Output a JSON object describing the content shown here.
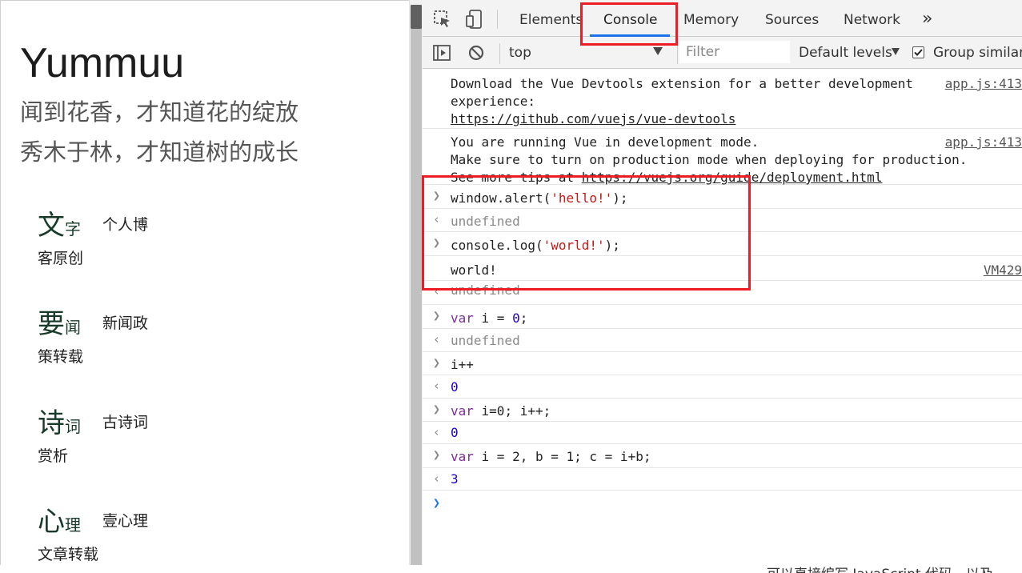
{
  "page": {
    "site_title": "Yummuu",
    "tagline_line1": "闻到花香，才知道花的绽放",
    "tagline_line2": "秀木于林，才知道树的成长",
    "categories": [
      {
        "big": "文",
        "small": "字",
        "desc1": "个人博",
        "desc2": "客原创"
      },
      {
        "big": "要",
        "small": "闻",
        "desc1": "新闻政",
        "desc2": "策转载"
      },
      {
        "big": "诗",
        "small": "词",
        "desc1": "古诗词",
        "desc2": "赏析"
      },
      {
        "big": "心",
        "small": "理",
        "desc1": "壹心理",
        "desc2": "文章转载"
      }
    ]
  },
  "devtools": {
    "tabs": [
      "Elements",
      "Console",
      "Memory",
      "Sources",
      "Network"
    ],
    "more_tabs": "»",
    "active_tab": "Console",
    "context": "top",
    "filter_placeholder": "Filter",
    "levels": "Default levels",
    "group_similar": "Group similar",
    "accent": "#1a73e8",
    "highlight": "#ee1c25"
  },
  "console": {
    "msg1_line1": "Download the Vue Devtools extension for a better development",
    "msg1_line2": "experience:",
    "msg1_link": "https://github.com/vuejs/vue-devtools",
    "msg1_src": "app.js:413",
    "msg2_line1": "You are running Vue in development mode.",
    "msg2_line2": "Make sure to turn on production mode when deploying for production.",
    "msg2_line3_prefix": "See more tips at ",
    "msg2_link": "https://vuejs.org/guide/deployment.html",
    "msg2_src": "app.js:413",
    "in1_a": "window.alert(",
    "in1_str": "'hello!'",
    "in1_b": ");",
    "out1": "undefined",
    "in2_a": "console.log(",
    "in2_str": "'world!'",
    "in2_b": ");",
    "log2": "world!",
    "log2_src": "VM429",
    "out2": "undefined",
    "in3_kw": "var",
    "in3_a": " i = ",
    "in3_num": "0",
    "in3_b": ";",
    "out3": "undefined",
    "in4": "i++",
    "out4": "0",
    "in5_kw": "var",
    "in5_a": " i=0; i++;",
    "out5": "0",
    "in6_kw": "var",
    "in6_a": " i = 2, b = 1; c = i+b;",
    "out6": "3"
  },
  "bottom": {
    "text": "可以直接编写 JavaScript 代码，以及"
  }
}
